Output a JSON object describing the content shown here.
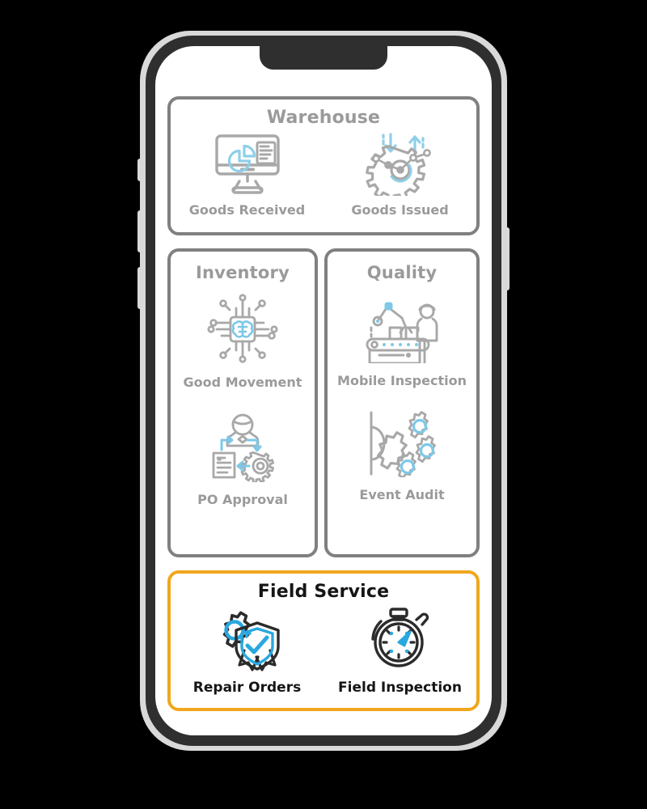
{
  "device": {
    "type": "smartphone-mockup",
    "frame_color": "#2f2f2f",
    "bezel_color": "#d9d9d9",
    "screen_color": "#ffffff"
  },
  "theme": {
    "muted_gray": "#9a9a9a",
    "border_gray": "#808080",
    "accent_orange": "#f0a71c",
    "icon_blue": "#7ec8e8",
    "icon_blue_strong": "#29a8e0",
    "dark_text": "#151515"
  },
  "cards": [
    {
      "id": "warehouse",
      "title": "Warehouse",
      "highlighted": false,
      "tiles": [
        {
          "label": "Goods Received",
          "icon": "monitor-pie-chart-icon"
        },
        {
          "label": "Goods Issued",
          "icon": "gear-arrows-icon"
        }
      ]
    },
    {
      "id": "inventory",
      "title": "Inventory",
      "highlighted": false,
      "tiles": [
        {
          "label": "Good Movement",
          "icon": "chip-brain-icon"
        },
        {
          "label": "PO Approval",
          "icon": "document-approval-icon"
        }
      ]
    },
    {
      "id": "quality",
      "title": "Quality",
      "highlighted": false,
      "tiles": [
        {
          "label": "Mobile Inspection",
          "icon": "conveyor-worker-icon"
        },
        {
          "label": "Event Audit",
          "icon": "gears-cluster-icon"
        }
      ]
    },
    {
      "id": "field_service",
      "title": "Field Service",
      "highlighted": true,
      "tiles": [
        {
          "label": "Repair Orders",
          "icon": "gear-shield-check-icon"
        },
        {
          "label": "Field Inspection",
          "icon": "stopwatch-icon"
        }
      ]
    }
  ],
  "hardware_buttons": [
    {
      "name": "mute-switch"
    },
    {
      "name": "volume-up-button"
    },
    {
      "name": "volume-down-button"
    },
    {
      "name": "power-button"
    }
  ]
}
